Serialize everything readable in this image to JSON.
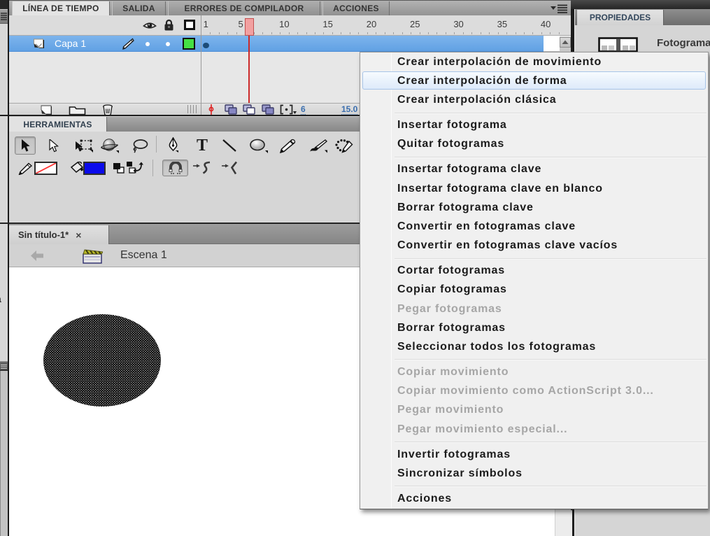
{
  "panel_tabs": {
    "timeline_group": [
      {
        "label": "LÍNEA DE TIEMPO",
        "active": true
      },
      {
        "label": "SALIDA",
        "active": false
      },
      {
        "label": "ERRORES DE COMPILADOR",
        "active": false
      },
      {
        "label": "ACCIONES",
        "active": false
      }
    ],
    "tools_tab": "HERRAMIENTAS",
    "properties_tab": "PROPIEDADES"
  },
  "timeline": {
    "layer_name": "Capa 1",
    "ruler_numbers": [
      1,
      5,
      10,
      15,
      20,
      25,
      30,
      35,
      40
    ],
    "current_frame": "6",
    "frame_rate": "15.0",
    "playhead_frame": 6
  },
  "document": {
    "tab_label": "Sin título-1*",
    "close_label": "×",
    "scene_label": "Escena 1"
  },
  "properties": {
    "selection_title": "Fotograma"
  },
  "context_menu": {
    "items": [
      {
        "label": "Crear interpolación de movimiento"
      },
      {
        "label": "Crear interpolación de forma",
        "highlighted": true
      },
      {
        "label": "Crear interpolación clásica"
      },
      {
        "separator": true
      },
      {
        "label": "Insertar fotograma"
      },
      {
        "label": "Quitar fotogramas"
      },
      {
        "separator": true
      },
      {
        "label": "Insertar fotograma clave"
      },
      {
        "label": "Insertar fotograma clave en blanco"
      },
      {
        "label": "Borrar fotograma clave"
      },
      {
        "label": "Convertir en fotogramas clave"
      },
      {
        "label": "Convertir en fotogramas clave vacíos"
      },
      {
        "separator": true
      },
      {
        "label": "Cortar fotogramas"
      },
      {
        "label": "Copiar fotogramas"
      },
      {
        "label": "Pegar fotogramas",
        "disabled": true
      },
      {
        "label": "Borrar fotogramas"
      },
      {
        "label": "Seleccionar todos los fotogramas"
      },
      {
        "separator": true
      },
      {
        "label": "Copiar movimiento",
        "disabled": true
      },
      {
        "label": "Copiar movimiento como ActionScript 3.0...",
        "disabled": true
      },
      {
        "label": "Pegar movimiento",
        "disabled": true
      },
      {
        "label": "Pegar movimiento especial...",
        "disabled": true
      },
      {
        "separator": true
      },
      {
        "label": "Invertir fotogramas"
      },
      {
        "label": "Sincronizar símbolos"
      },
      {
        "separator": true
      },
      {
        "label": "Acciones"
      }
    ]
  },
  "colors": {
    "layer_row_blue": "#69a7e8",
    "fill_swatch": "#0b0beb",
    "outline_swatch": "#4ce04c",
    "playhead_red": "#cc2a2a"
  }
}
